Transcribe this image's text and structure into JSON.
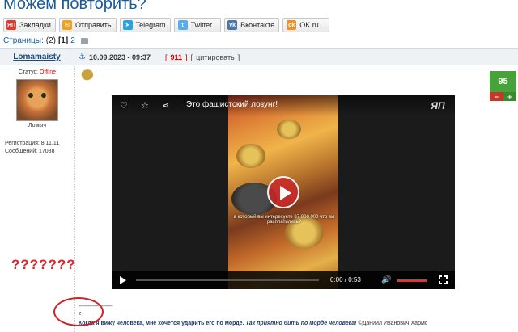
{
  "page": {
    "title": "Можем повторить?"
  },
  "share_bar": [
    {
      "label": "Закладки",
      "icon": "yap-icon",
      "color": "#e03a2c"
    },
    {
      "label": "Отправить",
      "icon": "mail-icon",
      "color": "#f0a020"
    },
    {
      "label": "Telegram",
      "icon": "telegram-icon",
      "color": "#2aa3e0"
    },
    {
      "label": "Twitter",
      "icon": "twitter-icon",
      "color": "#55acee"
    },
    {
      "label": "Вконтакте",
      "icon": "vk-icon",
      "color": "#4a76a8"
    },
    {
      "label": "OK.ru",
      "icon": "ok-icon",
      "color": "#f2902a"
    }
  ],
  "pager": {
    "label": "Страницы:",
    "total": "(2)",
    "current": "[1]",
    "next": "2"
  },
  "post": {
    "author": "Lomamaisty",
    "date": "10.09.2023 - 09:37",
    "number": "911",
    "quote_label": "цитировать",
    "rating": "95",
    "rating_minus": "−",
    "rating_plus": "+"
  },
  "profile": {
    "status_label": "Статус:",
    "status_value": "Offline",
    "nickname": "Ломыч",
    "registration": "Регистрация: 8.11.11",
    "messages": "Сообщений: 17088"
  },
  "video": {
    "title": "Это фашистский лозунг!",
    "logo": "ЯП",
    "time": "0:00 / 0:53",
    "caption": "а который вы интересуете 37 000 000 что вы расплатились?"
  },
  "annotation": {
    "marks": "???????"
  },
  "signature": {
    "separator": "-------------------",
    "letter": "z",
    "quote_part1": "Когда я вижу человека, мне хочется ударить его по морде.",
    "quote_part2": "Так приятно бить по морде человека!",
    "author": "©Даниил Иванович Хармс"
  }
}
